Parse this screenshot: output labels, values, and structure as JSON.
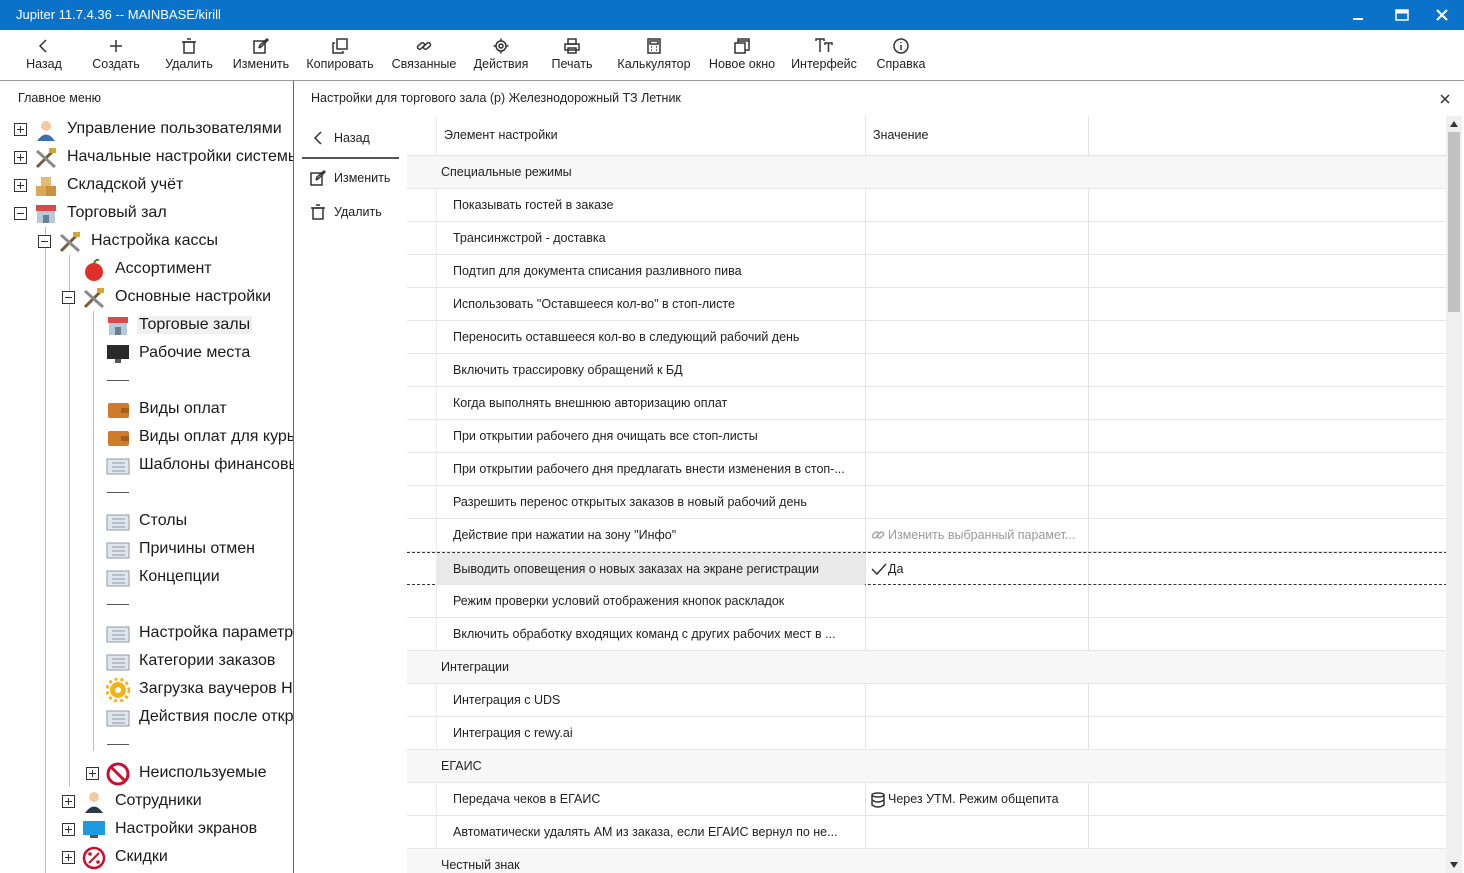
{
  "window": {
    "title": "Jupiter 11.7.4.36 -- MAINBASE/kirill"
  },
  "toolbar": {
    "buttons": [
      {
        "label": "Назад",
        "icon": "chevron-left-icon"
      },
      {
        "label": "Создать",
        "icon": "plus-icon"
      },
      {
        "label": "Удалить",
        "icon": "trash-icon"
      },
      {
        "label": "Изменить",
        "icon": "edit-icon"
      },
      {
        "label": "Копировать",
        "icon": "copy-icon"
      },
      {
        "label": "Связанные",
        "icon": "link-icon"
      },
      {
        "label": "Действия",
        "icon": "gear-icon"
      },
      {
        "label": "Печать",
        "icon": "printer-icon"
      },
      {
        "label": "Калькулятор",
        "icon": "calculator-icon"
      },
      {
        "label": "Новое окно",
        "icon": "new-window-icon"
      },
      {
        "label": "Интерфейс",
        "icon": "font-icon"
      },
      {
        "label": "Справка",
        "icon": "info-icon"
      }
    ]
  },
  "left_panel": {
    "title": "Главное меню",
    "tree": [
      {
        "label": "Управление пользователями",
        "icon": "user-icon"
      },
      {
        "label": "Начальные настройки системы",
        "icon": "tools-icon"
      },
      {
        "label": "Складской учёт",
        "icon": "boxes-icon"
      },
      {
        "label": "Торговый зал",
        "icon": "store-icon"
      },
      {
        "label": "Настройка кассы",
        "icon": "tools-icon"
      },
      {
        "label": "Ассортимент",
        "icon": "apple-icon"
      },
      {
        "label": "Основные настройки",
        "icon": "tools-icon"
      },
      {
        "label": "Торговые залы",
        "icon": "store-icon"
      },
      {
        "label": "Рабочие места",
        "icon": "monitor-icon"
      },
      {
        "label": "Виды оплат",
        "icon": "wallet-icon"
      },
      {
        "label": "Виды оплат для курье",
        "icon": "wallet-icon"
      },
      {
        "label": "Шаблоны финансовы",
        "icon": "list-icon"
      },
      {
        "label": "Столы",
        "icon": "list-icon"
      },
      {
        "label": "Причины отмен",
        "icon": "list-icon"
      },
      {
        "label": "Концепции",
        "icon": "list-icon"
      },
      {
        "label": "Настройка параметр",
        "icon": "list-icon"
      },
      {
        "label": "Категории заказов",
        "icon": "list-icon"
      },
      {
        "label": "Загрузка ваучеров Н",
        "icon": "gear-icon"
      },
      {
        "label": "Действия после откр",
        "icon": "list-icon"
      },
      {
        "label": "Неиспользуемые",
        "icon": "forbidden-icon"
      },
      {
        "label": "Сотрудники",
        "icon": "employee-icon"
      },
      {
        "label": "Настройки экранов",
        "icon": "screen-icon"
      },
      {
        "label": "Скидки",
        "icon": "discount-icon"
      }
    ]
  },
  "right_panel": {
    "title": "Настройки для торгового зала (р) Железнодорожный ТЗ Летник",
    "sidenav": {
      "back": "Назад",
      "edit": "Изменить",
      "delete": "Удалить"
    },
    "columns": {
      "element": "Элемент настройки",
      "value": "Значение"
    },
    "rows": [
      {
        "element": "Специальные режимы",
        "value": ""
      },
      {
        "element": "Показывать гостей в заказе",
        "value": ""
      },
      {
        "element": "Трансинжстрой - доставка",
        "value": ""
      },
      {
        "element": "Подтип для документа списания разливного пива",
        "value": ""
      },
      {
        "element": "Использовать \"Оставшееся кол-во\" в стоп-листе",
        "value": ""
      },
      {
        "element": "Переносить оставшееся кол-во в следующий рабочий день",
        "value": ""
      },
      {
        "element": "Включить трассировку обращений к БД",
        "value": ""
      },
      {
        "element": "Когда выполнять внешнюю авторизацию оплат",
        "value": ""
      },
      {
        "element": "При открытии рабочего дня очищать все стоп-листы",
        "value": ""
      },
      {
        "element": "При открытии рабочего дня предлагать внести изменения в стоп-...",
        "value": ""
      },
      {
        "element": "Разрешить перенос открытых заказов в новый рабочий день",
        "value": ""
      },
      {
        "element": "Действие при нажатии на зону \"Инфо\"",
        "value": "Изменить выбранный парамет..."
      },
      {
        "element": "Выводить оповещения о новых заказах на экране регистрации",
        "value": "Да"
      },
      {
        "element": "Режим проверки условий отображения кнопок раскладок",
        "value": ""
      },
      {
        "element": "Включить обработку входящих команд с других рабочих мест в ...",
        "value": ""
      },
      {
        "element": "Интеграции",
        "value": ""
      },
      {
        "element": "Интеграция с UDS",
        "value": ""
      },
      {
        "element": "Интеграция с rewy.ai",
        "value": ""
      },
      {
        "element": "ЕГАИС",
        "value": ""
      },
      {
        "element": "Передача чеков в ЕГАИС",
        "value": "Через УТМ. Режим общепита"
      },
      {
        "element": "Автоматически удалять АМ из заказа, если ЕГАИС вернул по не...",
        "value": ""
      },
      {
        "element": "Честный знак",
        "value": ""
      }
    ]
  },
  "colors": {
    "titlebar": "#0a73c9",
    "selection": "#e9e9e9"
  }
}
